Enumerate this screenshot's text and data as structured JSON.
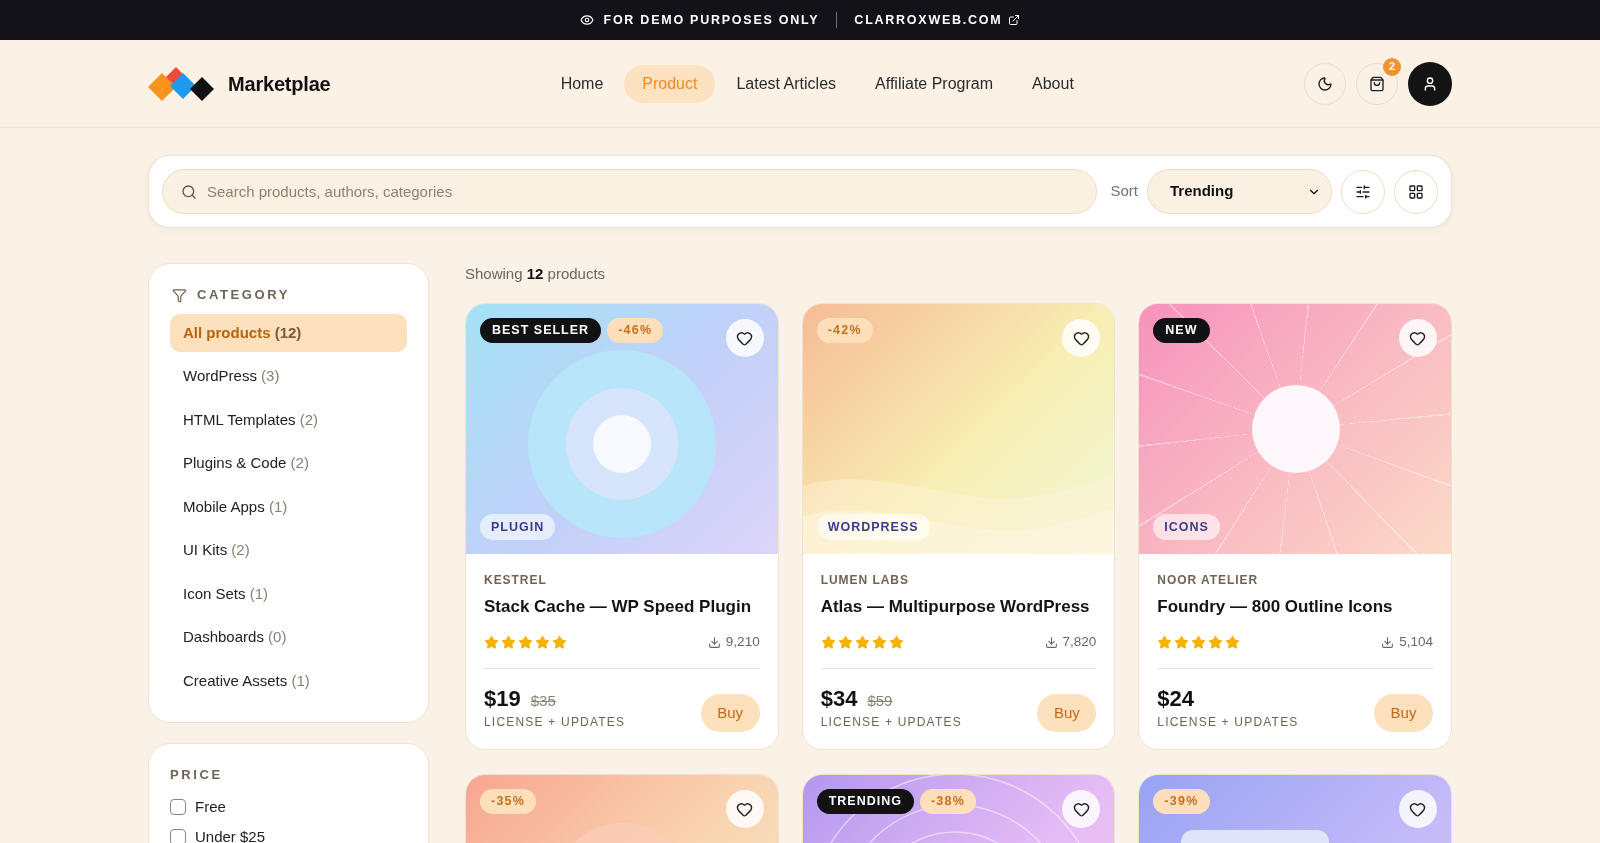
{
  "banner": {
    "notice": "FOR DEMO PURPOSES ONLY",
    "link": "CLARROXWEB.COM"
  },
  "header": {
    "brand": "Marketplae",
    "nav": [
      {
        "label": "Home",
        "selected": false
      },
      {
        "label": "Product",
        "selected": true
      },
      {
        "label": "Latest Articles",
        "selected": false
      },
      {
        "label": "Affiliate Program",
        "selected": false
      },
      {
        "label": "About",
        "selected": false
      }
    ],
    "cart_count": "2"
  },
  "search": {
    "placeholder": "Search products, authors, categories",
    "sort_label": "Sort",
    "sort_value": "Trending"
  },
  "sidebar": {
    "category": {
      "title": "CATEGORY",
      "items": [
        {
          "label": "All products",
          "count": "(12)",
          "selected": true
        },
        {
          "label": "WordPress",
          "count": "(3)",
          "selected": false
        },
        {
          "label": "HTML Templates",
          "count": "(2)",
          "selected": false
        },
        {
          "label": "Plugins & Code",
          "count": "(2)",
          "selected": false
        },
        {
          "label": "Mobile Apps",
          "count": "(1)",
          "selected": false
        },
        {
          "label": "UI Kits",
          "count": "(2)",
          "selected": false
        },
        {
          "label": "Icon Sets",
          "count": "(1)",
          "selected": false
        },
        {
          "label": "Dashboards",
          "count": "(0)",
          "selected": false
        },
        {
          "label": "Creative Assets",
          "count": "(1)",
          "selected": false
        }
      ]
    },
    "price": {
      "title": "PRICE",
      "options": [
        {
          "label": "Free",
          "checked": false
        },
        {
          "label": "Under $25",
          "checked": false
        }
      ]
    }
  },
  "results": {
    "summary": "Showing **12** products",
    "products": [
      {
        "kind": "orb",
        "badge": "BEST SELLER",
        "discount": "-46%",
        "tag": "PLUGIN",
        "vendor": "KESTREL",
        "title": "Stack Cache — WP Speed Plugin",
        "stars": 5,
        "downloads": "9,210",
        "price": "$19",
        "old_price": "$35",
        "license": "LICENSE + UPDATES",
        "action": "Buy"
      },
      {
        "kind": "dunes",
        "discount": "-42%",
        "tag": "WORDPRESS",
        "vendor": "LUMEN LABS",
        "title": "Atlas — Multipurpose WordPress",
        "stars": 5,
        "downloads": "7,820",
        "price": "$34",
        "old_price": "$59",
        "license": "LICENSE + UPDATES",
        "action": "Buy"
      },
      {
        "kind": "sunburst",
        "badge": "NEW",
        "tag": "ICONS",
        "vendor": "NOOR ATELIER",
        "title": "Foundry — 800 Outline Icons",
        "stars": 5,
        "downloads": "5,104",
        "price": "$24",
        "license": "LICENSE + UPDATES",
        "action": "Buy"
      },
      {
        "kind": "glow",
        "discount": "-35%"
      },
      {
        "kind": "ripples",
        "badge": "TRENDING",
        "discount": "-38%"
      },
      {
        "kind": "panel",
        "discount": "-39%"
      }
    ]
  }
}
